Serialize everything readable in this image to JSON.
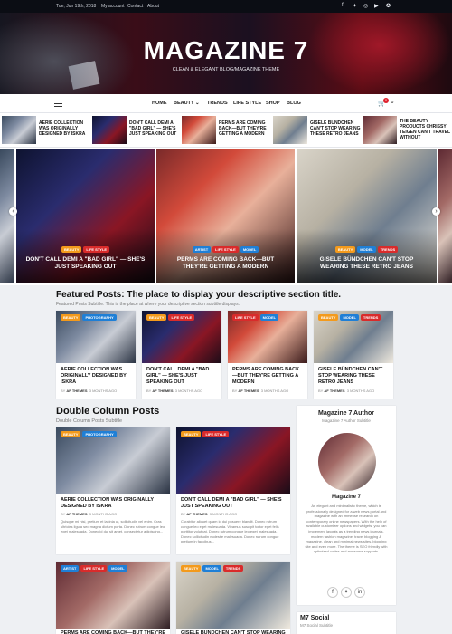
{
  "topbar": {
    "date": "Tue, Jun 19th, 2018",
    "links": [
      "My account",
      "Contact",
      "About"
    ],
    "social_icons": [
      "facebook-icon",
      "twitter-icon",
      "instagram-icon",
      "youtube-icon",
      "vk-icon"
    ]
  },
  "site": {
    "title": "MAGAZINE 7",
    "tagline": "CLEAN & ELEGANT BLOG/MAGAZINE THEME"
  },
  "nav": {
    "items": [
      "HOME",
      "BEAUTY",
      "TRENDS",
      "LIFE STYLE",
      "SHOP",
      "BLOG"
    ],
    "cart_count": "0"
  },
  "ticker": [
    "AERIE COLLECTION WAS ORIGINALLY DESIGNED BY ISKRA",
    "DON'T CALL DEMI A \"BAD GIRL\" — SHE'S JUST SPEAKING OUT",
    "PERMS ARE COMING BACK—BUT THEY'RE GETTING A MODERN",
    "GISELE BÜNDCHEN CAN'T STOP WEARING THESE RETRO JEANS",
    "THE BEAUTY PRODUCTS CHRISSY TEIGEN CAN'T TRAVEL WITHOUT"
  ],
  "slider": [
    {
      "cats": [
        "BEAUTY",
        "LIFE STYLE"
      ],
      "title": "DON'T CALL DEMI A \"BAD GIRL\" — SHE'S JUST SPEAKING OUT"
    },
    {
      "cats": [
        "ARTIST",
        "LIFE STYLE",
        "MODEL"
      ],
      "title": "PERMS ARE COMING BACK—BUT THEY'RE GETTING A MODERN"
    },
    {
      "cats": [
        "BEAUTY",
        "MODEL",
        "TRENDS"
      ],
      "title": "GISELE BÜNDCHEN CAN'T STOP WEARING THESE RETRO JEANS"
    }
  ],
  "featured": {
    "title": "Featured Posts: The place to display your descriptive section title.",
    "subtitle": "Featured Posts Subtitle: This is the place at where your descriptive section subtitle displays.",
    "posts": [
      {
        "cats": [
          "BEAUTY",
          "PHOTOGRAPHY"
        ],
        "title": "AERIE COLLECTION WAS ORIGINALLY DESIGNED BY ISKRA",
        "author": "AF THEMES",
        "time": "3 MONTHS AGO"
      },
      {
        "cats": [
          "BEAUTY",
          "LIFE STYLE"
        ],
        "title": "DON'T CALL DEMI A \"BAD GIRL\" — SHE'S JUST SPEAKING OUT",
        "author": "AF THEMES",
        "time": "3 MONTHS AGO"
      },
      {
        "cats": [
          "LIFE STYLE",
          "MODEL"
        ],
        "title": "PERMS ARE COMING BACK—BUT THEY'RE GETTING A MODERN",
        "author": "AF THEMES",
        "time": "3 MONTHS AGO"
      },
      {
        "cats": [
          "BEAUTY",
          "MODEL",
          "TRENDS"
        ],
        "title": "GISELE BÜNDCHEN CAN'T STOP WEARING THESE RETRO JEANS",
        "author": "AF THEMES",
        "time": "3 MONTHS AGO"
      }
    ]
  },
  "double": {
    "title": "Double Column Posts",
    "subtitle": "Double Column Posts Subtitle",
    "posts": [
      {
        "cats": [
          "BEAUTY",
          "PHOTOGRAPHY"
        ],
        "title": "AERIE COLLECTION WAS ORIGINALLY DESIGNED BY ISKRA",
        "author": "AF THEMES",
        "time": "3 MONTHS AGO",
        "excerpt": "Quisque mi nisi, pretium et lacinia ut, sollicitudin vel enim. Cras ultricies ligula sed magna dictum porta. Donec rutrum congue leo eget malesuada. Donec id dui sit amet, consectetur adipiscing..."
      },
      {
        "cats": [
          "BEAUTY",
          "LIFE STYLE"
        ],
        "title": "DON'T CALL DEMI A \"BAD GIRL\" — SHE'S JUST SPEAKING OUT",
        "author": "AF THEMES",
        "time": "3 MONTHS AGO",
        "excerpt": "Curabitur aliquet quam id dui posuere blandit. Donec rutrum congue leo eget malesuada. Vivamus suscipit tortor eget felis porttitor volutpat. Donec rutrum congue leo eget malesuada. Donec sollicitudin molestie malesuada. Donec rutrum congue pretium in faucibus..."
      },
      {
        "cats": [
          "ARTIST",
          "LIFE STYLE",
          "MODEL"
        ],
        "title": "PERMS ARE COMING BACK—BUT THEY'RE",
        "author": "",
        "time": "",
        "excerpt": ""
      },
      {
        "cats": [
          "BEAUTY",
          "MODEL",
          "TRENDS"
        ],
        "title": "GISELE BÜNDCHEN CAN'T STOP WEARING",
        "author": "",
        "time": "",
        "excerpt": ""
      }
    ]
  },
  "author_widget": {
    "title": "Magazine 7 Author",
    "subtitle": "Magazine 7 Author Subtitle",
    "name": "Magazine 7",
    "bio": "An elegant and minimalistic theme, which is professionally designed for a web news portal and magazine with an immense research on contemporary online newspapers. With the help of available customizer options and widgets, you can implement layouts as a trending news journals, modern fashion magazine, travel blogging & magazine, clean and minimal news sites, blogging site and even more. The theme is SEO friendly with optimized codes and awesome supports.",
    "social_icons": [
      "facebook-icon",
      "twitter-icon",
      "linkedin-icon"
    ]
  },
  "social_widget": {
    "title": "M7 Social",
    "subtitle": "M7 Social Subtitle"
  },
  "colors": {
    "accent_red": "#d92b2b",
    "tag_orange": "#f39a1c",
    "tag_blue": "#1f7fd6",
    "topbar": "#0b0d14"
  }
}
